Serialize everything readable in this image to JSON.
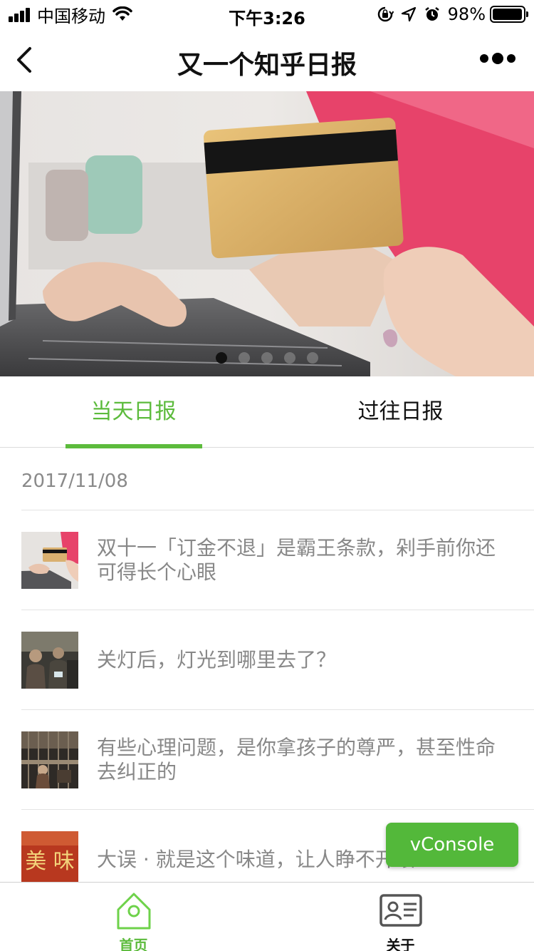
{
  "status_bar": {
    "carrier": "中国移动",
    "time": "下午3:26",
    "battery_percent_label": "98%",
    "battery_level": 0.98
  },
  "nav": {
    "title": "又一个知乎日报"
  },
  "banner": {
    "slide_count": 5,
    "active_slide": 1
  },
  "tabs": [
    {
      "label": "当天日报",
      "active": true
    },
    {
      "label": "过往日报",
      "active": false
    }
  ],
  "list": {
    "date": "2017/11/08",
    "items": [
      {
        "title": "双十一「订金不退」是霸王条款，剁手前你还可得长个心眼"
      },
      {
        "title": "关灯后，灯光到哪里去了？"
      },
      {
        "title": "有些心理问题，是你拿孩子的尊严，甚至性命去纠正的"
      },
      {
        "title": "大误 · 就是这个味道，让人睁不开眼"
      }
    ]
  },
  "vconsole": {
    "label": "vConsole"
  },
  "tabbar": [
    {
      "label": "首页",
      "icon": "home-icon",
      "active": true
    },
    {
      "label": "关于",
      "icon": "profile-card-icon",
      "active": false
    }
  ],
  "colors": {
    "accent": "#5cbb3c",
    "vconsole": "#53b83a"
  }
}
